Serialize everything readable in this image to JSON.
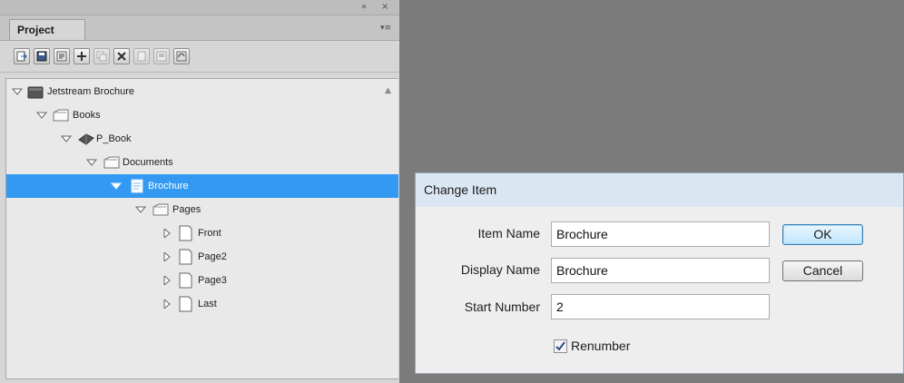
{
  "panel": {
    "tab_label": "Project",
    "collapse_glyph": "«",
    "close_glyph": "×",
    "menu_glyph": "▾≡",
    "toolbar_icons": [
      "import-icon",
      "save-icon",
      "properties-icon",
      "add-icon",
      "duplicate-icon",
      "delete-icon",
      "new-page-icon",
      "layout-icon",
      "sync-icon"
    ]
  },
  "tree": {
    "items": [
      {
        "label": "Jetstream Brochure",
        "icon": "project-icon",
        "expanded": true
      },
      {
        "label": "Books",
        "icon": "folder-icon",
        "expanded": true
      },
      {
        "label": "P_Book",
        "icon": "book-icon",
        "expanded": true
      },
      {
        "label": "Documents",
        "icon": "folder-icon",
        "expanded": true
      },
      {
        "label": "Brochure",
        "icon": "document-icon",
        "expanded": true,
        "selected": true
      },
      {
        "label": "Pages",
        "icon": "folder-icon",
        "expanded": true
      },
      {
        "label": "Front",
        "icon": "page-icon",
        "expanded": false
      },
      {
        "label": "Page2",
        "icon": "page-icon",
        "expanded": false
      },
      {
        "label": "Page3",
        "icon": "page-icon",
        "expanded": false
      },
      {
        "label": "Last",
        "icon": "page-icon",
        "expanded": false
      }
    ]
  },
  "dialog": {
    "title": "Change Item",
    "item_name_label": "Item Name",
    "item_name_value": "Brochure",
    "display_name_label": "Display Name",
    "display_name_value": "Brochure",
    "start_number_label": "Start Number",
    "start_number_value": "2",
    "ok_label": "OK",
    "cancel_label": "Cancel",
    "renumber_label": "Renumber",
    "renumber_checked": true
  },
  "colors": {
    "selection": "#3399f3",
    "desktop": "#7b7b7b",
    "dialog_title_bg": "#dbe6f3"
  }
}
